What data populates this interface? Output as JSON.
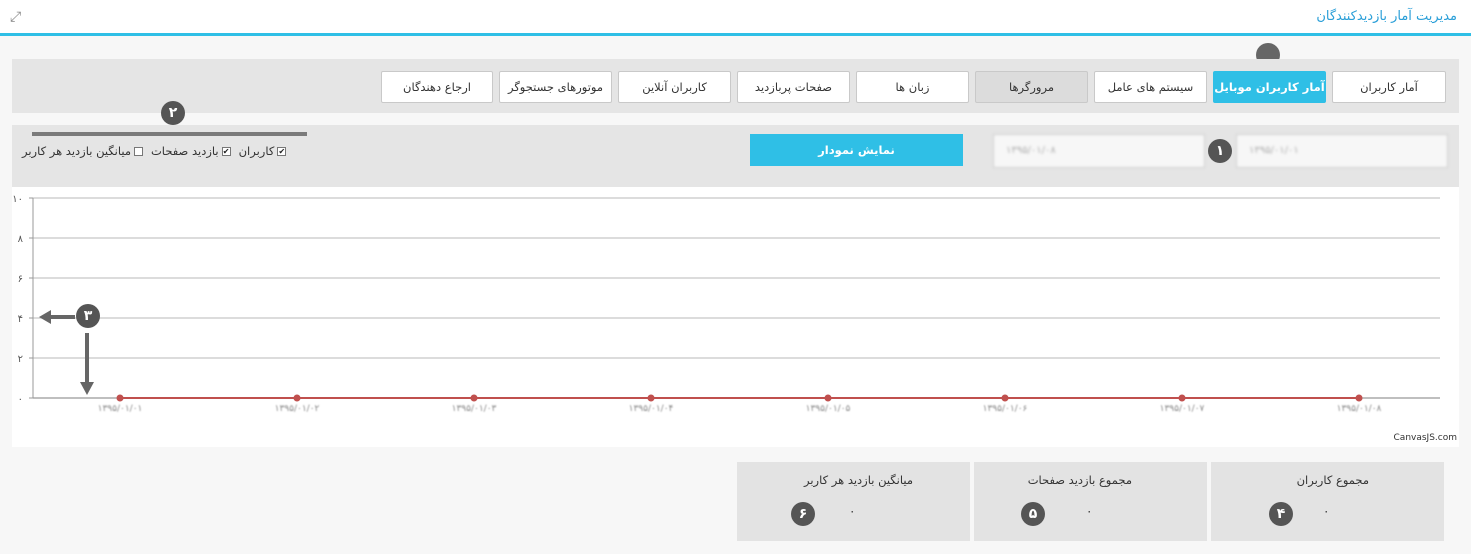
{
  "header": {
    "title": "مدیریت آمار بازدیدکنندگان",
    "expand_icon": "expand-icon"
  },
  "tabs": [
    {
      "label": "آمار کاربران"
    },
    {
      "label": "آمار کاربران موبایل"
    },
    {
      "label": "سیستم های عامل"
    },
    {
      "label": "مرورگرها"
    },
    {
      "label": "زبان ها"
    },
    {
      "label": "صفحات پربازدید"
    },
    {
      "label": "کاربران آنلاین"
    },
    {
      "label": "موتورهای جستجوگر"
    },
    {
      "label": "ارجاع دهندگان"
    }
  ],
  "filter": {
    "date_from": "۱۳۹۵/۰۱/۰۱",
    "date_to": "۱۳۹۵/۰۱/۰۸",
    "show_button": "نمایش نمودار",
    "checkboxes": [
      {
        "label": "کاربران",
        "checked": true,
        "mark": "✔"
      },
      {
        "label": "بازدید صفحات",
        "checked": true,
        "mark": "✔"
      },
      {
        "label": "میانگین بازدید هر کاربر",
        "checked": false,
        "mark": ""
      }
    ]
  },
  "callouts": {
    "c1": "۱",
    "c2": "۲",
    "c3": "۳",
    "c4": "۴",
    "c5": "۵",
    "c6": "۶"
  },
  "chart_data": {
    "type": "line",
    "x": [
      "۱۳۹۵/۰۱/۰۱",
      "۱۳۹۵/۰۱/۰۲",
      "۱۳۹۵/۰۱/۰۳",
      "۱۳۹۵/۰۱/۰۴",
      "۱۳۹۵/۰۱/۰۵",
      "۱۳۹۵/۰۱/۰۶",
      "۱۳۹۵/۰۱/۰۷",
      "۱۳۹۵/۰۱/۰۸"
    ],
    "series": [
      {
        "values": [
          0,
          0,
          0,
          0,
          0,
          0,
          0,
          0
        ],
        "color": "#c0504e"
      }
    ],
    "y_ticks": [
      "۰",
      "۲",
      "۴",
      "۶",
      "۸",
      "۱۰"
    ],
    "ylim": [
      0,
      10
    ],
    "grid": true,
    "credit": "CanvasJS.com"
  },
  "stats": [
    {
      "label": "مجموع کاربران",
      "value": "۰"
    },
    {
      "label": "مجموع بازدید صفحات",
      "value": "۰"
    },
    {
      "label": "میانگین بازدید هر کاربر",
      "value": "۰"
    }
  ],
  "colors": {
    "accent": "#2fbfe6",
    "series": "#c0504e",
    "panel": "#e5e5e5"
  }
}
